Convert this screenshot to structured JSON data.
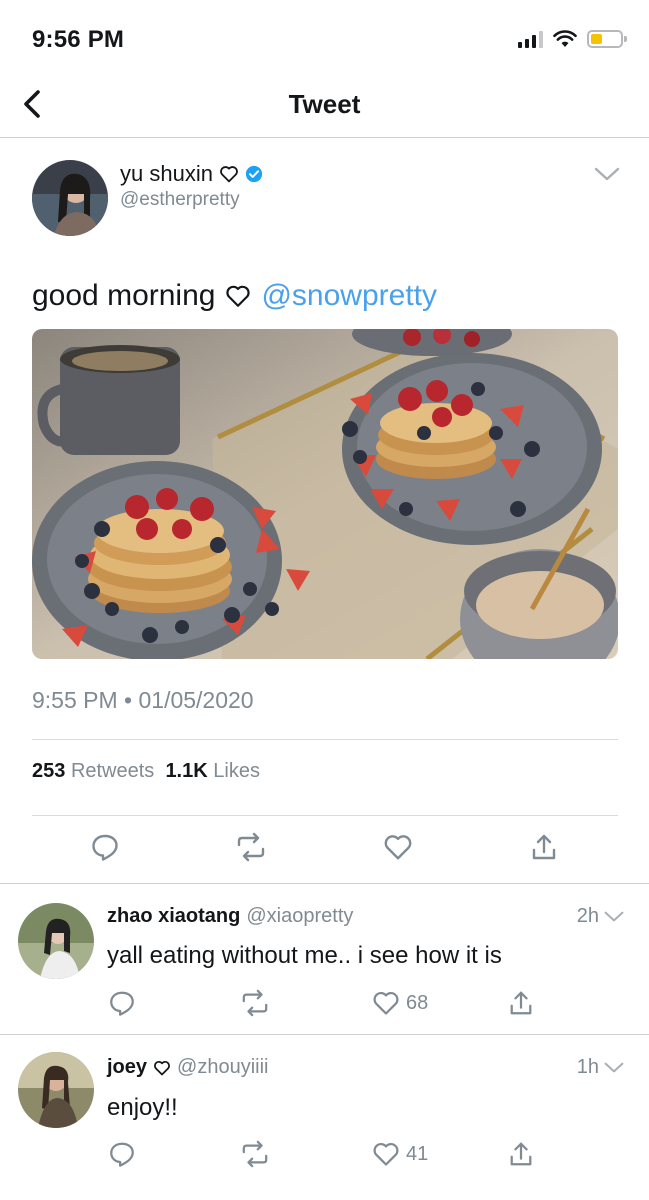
{
  "status_bar": {
    "time": "9:56 PM"
  },
  "nav": {
    "title": "Tweet"
  },
  "tweet": {
    "author_name": "yu shuxin",
    "author_handle": "@estherpretty",
    "text": "good morning",
    "mention": "@snowpretty",
    "timestamp": "9:55 PM • 01/05/2020",
    "retweet_count": "253",
    "retweet_label": "Retweets",
    "like_count": "1.1K",
    "like_label": "Likes"
  },
  "replies": [
    {
      "name": "zhao xiaotang",
      "handle": "@xiaopretty",
      "age": "2h",
      "text": "yall eating without me.. i see how it is",
      "like_count": "68"
    },
    {
      "name": "joey",
      "handle": "@zhouyiiii",
      "age": "1h",
      "text": "enjoy!!",
      "like_count": "41"
    }
  ],
  "colors": {
    "link": "#4aa1eb",
    "verified": "#1da1f2",
    "secondary_text": "#7f8a93",
    "battery": "#f5c400"
  },
  "icons": [
    "back-chevron-icon",
    "heart-outline-icon",
    "verified-badge-icon",
    "chevron-down-icon",
    "reply-icon",
    "retweet-icon",
    "like-icon",
    "share-icon"
  ]
}
